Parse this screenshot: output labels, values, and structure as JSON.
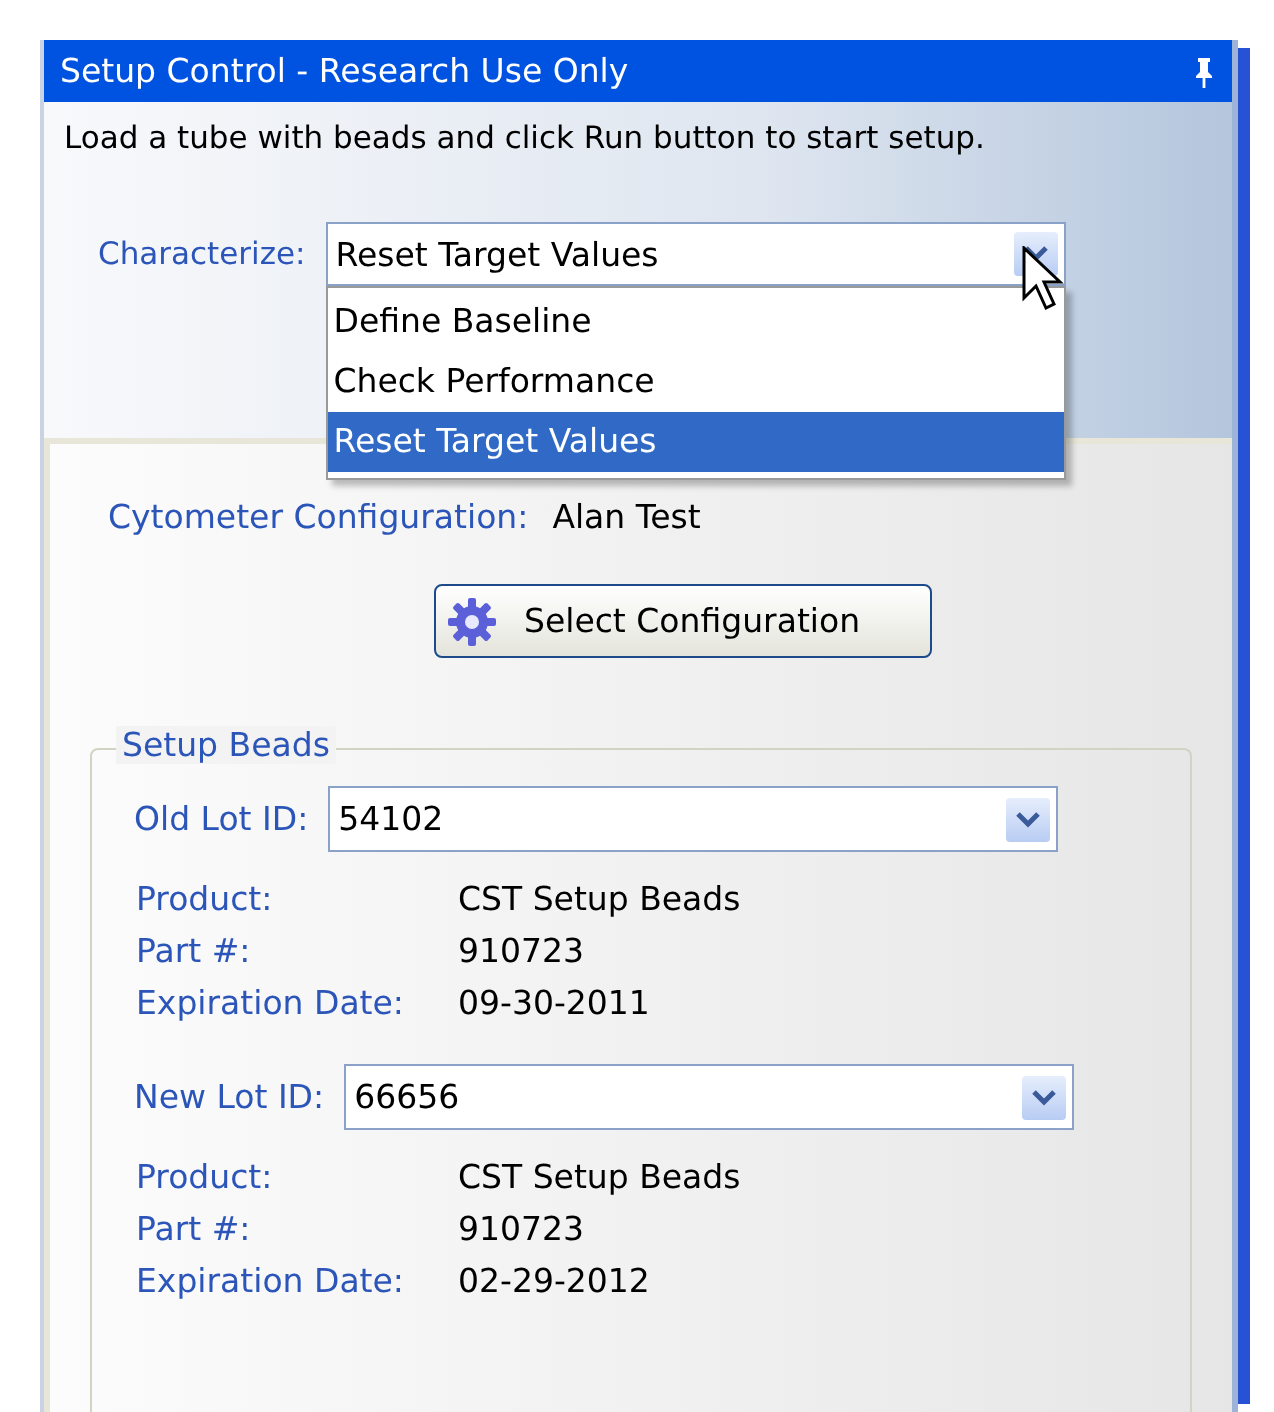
{
  "window": {
    "title": "Setup Control - Research Use Only"
  },
  "instruction": "Load a tube with beads and click Run button to start setup.",
  "characterize": {
    "label": "Characterize:",
    "value": "Reset Target Values",
    "expanded": true,
    "options": [
      {
        "label": "Define Baseline",
        "selected": false
      },
      {
        "label": "Check Performance",
        "selected": false
      },
      {
        "label": "Reset Target Values",
        "selected": true
      }
    ]
  },
  "configuration": {
    "label": "Cytometer Configuration:",
    "value": "Alan Test",
    "button": "Select Configuration"
  },
  "setup_beads": {
    "title": "Setup Beads",
    "lots": [
      {
        "label": "Old Lot ID:",
        "value": "54102",
        "details": [
          {
            "label": "Product:",
            "value": "CST Setup Beads"
          },
          {
            "label": "Part #:",
            "value": "910723"
          },
          {
            "label": "Expiration Date:",
            "value": "09-30-2011"
          }
        ]
      },
      {
        "label": "New Lot ID:",
        "value": "66656",
        "details": [
          {
            "label": "Product:",
            "value": "CST Setup Beads"
          },
          {
            "label": "Part #:",
            "value": "910723"
          },
          {
            "label": "Expiration Date:",
            "value": "02-29-2012"
          }
        ]
      }
    ]
  }
}
